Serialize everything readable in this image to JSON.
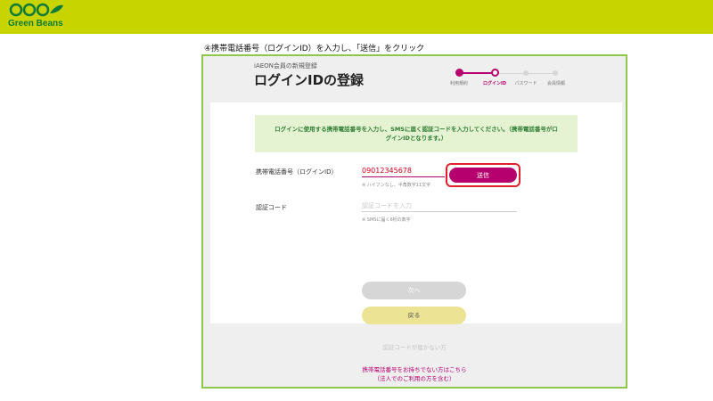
{
  "brand": {
    "name": "Green Beans",
    "color": "#c8d400"
  },
  "instruction": "④携帯電話番号（ログインID）を入力し、「送信」をクリック",
  "screen": {
    "pre_title": "iAEON会員の新規登録",
    "title": "ログインIDの登録",
    "steps": [
      {
        "label": "利用規約",
        "state": "done"
      },
      {
        "label": "ログインID",
        "state": "current"
      },
      {
        "label": "パスワード",
        "state": "todo"
      },
      {
        "label": "会員情報",
        "state": "todo"
      }
    ],
    "notice": "ログインに使用する携帯電話番号を入力し、SMSに届く認証コードを入力してください。（携帯電話番号がログインIDとなります。）",
    "phone": {
      "label": "携帯電話番号（ログインID）",
      "value": "09012345678",
      "hint": "※ ハイフンなし、半角数字11文字",
      "send_label": "送信"
    },
    "code": {
      "label": "認証コード",
      "placeholder": "認証コードを入力",
      "hint": "※ SMSに届く6桁の数字"
    },
    "next_label": "次へ",
    "back_label": "戻る",
    "no_code_link": "認証コードが届かない方",
    "no_phone_link_1": "携帯電話番号をお持ちでない方はこちら",
    "no_phone_link_2": "（法人でのご利用の方を含む）"
  },
  "colors": {
    "accent": "#b5006e",
    "frame": "#8fc74a",
    "highlight": "#e0202a"
  }
}
